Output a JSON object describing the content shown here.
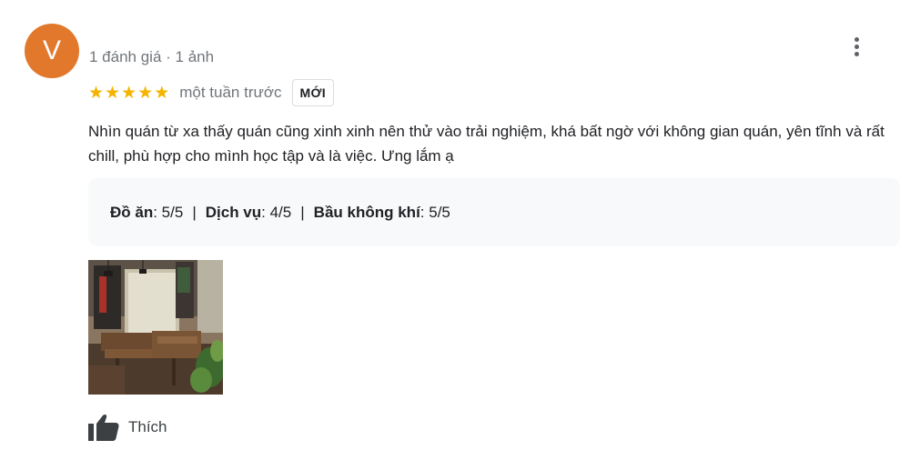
{
  "reviewer": {
    "initial": "V",
    "meta": "1 đánh giá · 1 ảnh",
    "avatar_color": "#e2782c"
  },
  "rating": {
    "stars": 5,
    "time_ago": "một tuần trước",
    "badge": "MỚI",
    "star_color": "#f4b400"
  },
  "review_text": "Nhìn quán từ xa thấy quán cũng xinh xinh nên thử vào trải nghiệm, khá bất ngờ với không gian quán, yên tĩnh và rất chill, phù hợp cho mình học tập và là việc. Ưng lắm ạ",
  "attributes": [
    {
      "label": "Đồ ăn",
      "value": ": 5/5"
    },
    {
      "label": "Dịch vụ",
      "value": ": 4/5"
    },
    {
      "label": "Bầu không khí",
      "value": ": 5/5"
    }
  ],
  "attribute_separator": "|",
  "actions": {
    "like_label": "Thích",
    "like_icon": "thumbs-up-icon",
    "more_icon": "more-vertical-icon"
  }
}
